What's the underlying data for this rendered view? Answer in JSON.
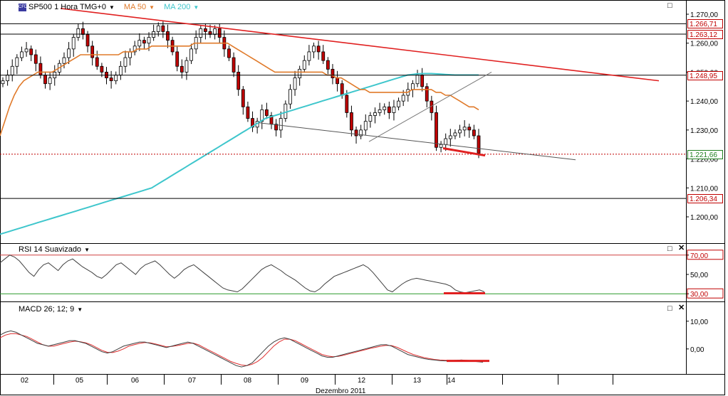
{
  "header": {
    "symbol": "SP500 1 Hora TMG+0",
    "ma50_label": "MA 50",
    "ma200_label": "MA 200",
    "rsi_label": "RSI 14 Suavizado",
    "macd_label": "MACD 26; 12; 9",
    "logo_text": "CFD"
  },
  "colors": {
    "candle_up": "#ffffff",
    "candle_down": "#c00000",
    "ma50": "#e07a2a",
    "ma200": "#3ec6cc",
    "trendline": "#e02020",
    "support": "#c00000",
    "macd": "#404040",
    "signal": "#e03030"
  },
  "axis": {
    "x_title": "Dezembro 2011",
    "day_labels": [
      "02",
      "05",
      "06",
      "07",
      "08",
      "09",
      "12",
      "13",
      "14"
    ],
    "price_ticks": [
      "1.270,00",
      "1.260,00",
      "1.250,00",
      "1.240,00",
      "1.230,00",
      "1.220,00",
      "1.210,00",
      "1.200,00"
    ],
    "rsi_ticks": [
      "70,00",
      "50,00",
      "30,00"
    ],
    "macd_ticks": [
      "10,00",
      "0,00"
    ]
  },
  "levels": [
    {
      "label": "1.266,71",
      "value": 1266.71,
      "color": "#c00000"
    },
    {
      "label": "1.263,12",
      "value": 1263.12,
      "color": "#c00000"
    },
    {
      "label": "1.248,95",
      "value": 1248.95,
      "color": "#c00000"
    },
    {
      "label": "1.221,66",
      "value": 1221.66,
      "color": "#208020"
    },
    {
      "label": "1.206,34",
      "value": 1206.34,
      "color": "#c00000"
    }
  ],
  "chart_data": [
    {
      "type": "candlestick",
      "title": "SP500 1 Hora TMG+0",
      "xlabel": "Dezembro 2011",
      "ylim": [
        1190,
        1272
      ],
      "categories": [
        "02",
        "05",
        "06",
        "07",
        "08",
        "09",
        "12",
        "13",
        "14"
      ],
      "close_series": [
        1247,
        1249,
        1252,
        1255,
        1257,
        1258,
        1256,
        1253,
        1249,
        1246,
        1248,
        1250,
        1253,
        1255,
        1258,
        1262,
        1265,
        1263,
        1259,
        1255,
        1252,
        1250,
        1248,
        1247,
        1249,
        1252,
        1255,
        1257,
        1259,
        1261,
        1260,
        1262,
        1264,
        1266,
        1264,
        1261,
        1257,
        1252,
        1250,
        1254,
        1258,
        1262,
        1265,
        1264,
        1263,
        1265,
        1262,
        1258,
        1255,
        1250,
        1244,
        1238,
        1234,
        1231,
        1233,
        1237,
        1235,
        1232,
        1230,
        1234,
        1239,
        1244,
        1248,
        1251,
        1254,
        1257,
        1259,
        1257,
        1254,
        1251,
        1248,
        1246,
        1242,
        1236,
        1230,
        1228,
        1230,
        1233,
        1235,
        1236,
        1237,
        1238,
        1236,
        1238,
        1240,
        1242,
        1244,
        1246,
        1249,
        1245,
        1240,
        1236,
        1224,
        1225,
        1227,
        1228,
        1229,
        1230,
        1231,
        1230,
        1228,
        1222
      ],
      "series": [
        {
          "name": "MA 50",
          "values": [
            1228,
            1233,
            1238,
            1242,
            1245,
            1247,
            1248,
            1249,
            1250,
            1250,
            1250,
            1250,
            1251,
            1252,
            1253,
            1254,
            1255,
            1256,
            1256,
            1256,
            1256,
            1256,
            1256,
            1256,
            1256,
            1256,
            1257,
            1257,
            1257,
            1258,
            1258,
            1258,
            1259,
            1259,
            1259,
            1259,
            1259,
            1259,
            1259,
            1259,
            1259,
            1260,
            1260,
            1260,
            1260,
            1260,
            1260,
            1260,
            1260,
            1259,
            1258,
            1257,
            1256,
            1255,
            1254,
            1253,
            1252,
            1251,
            1250,
            1250,
            1250,
            1250,
            1250,
            1250,
            1250,
            1250,
            1250,
            1250,
            1250,
            1249,
            1249,
            1248,
            1248,
            1247,
            1246,
            1245,
            1244,
            1244,
            1243,
            1243,
            1243,
            1243,
            1243,
            1243,
            1243,
            1243,
            1243,
            1244,
            1244,
            1244,
            1244,
            1244,
            1243,
            1243,
            1242,
            1242,
            1241,
            1240,
            1239,
            1238,
            1238,
            1237
          ]
        },
        {
          "name": "MA 200",
          "values": [
            1194,
            1194.5,
            1195,
            1195.5,
            1196,
            1196.5,
            1197,
            1197.5,
            1198,
            1198.5,
            1199,
            1199.5,
            1200,
            1200.5,
            1201,
            1201.5,
            1202,
            1202.5,
            1203,
            1203.5,
            1204,
            1204.5,
            1205,
            1205.5,
            1206,
            1206.5,
            1207,
            1207.5,
            1208,
            1208.5,
            1209,
            1209.5,
            1210,
            1211,
            1212,
            1213,
            1214,
            1215,
            1216,
            1217,
            1218,
            1219,
            1220,
            1221,
            1222,
            1223,
            1224,
            1225,
            1226,
            1227,
            1228,
            1229,
            1230,
            1231,
            1232,
            1233,
            1234,
            1234.5,
            1235,
            1235.5,
            1236,
            1236.5,
            1237,
            1237.5,
            1238,
            1238.5,
            1239,
            1239.5,
            1240,
            1240.5,
            1241,
            1241.5,
            1242,
            1242.5,
            1243,
            1243.5,
            1244,
            1244.5,
            1245,
            1245.5,
            1246,
            1246.5,
            1247,
            1247.5,
            1248,
            1248.5,
            1249,
            1249.2,
            1249.4,
            1249.5,
            1249.5,
            1249.5,
            1249.4,
            1249.3,
            1249.2,
            1249.1,
            1249.0,
            1249.0,
            1249.0,
            1249.0,
            1249.0,
            1249.0
          ]
        }
      ]
    },
    {
      "type": "line",
      "title": "RSI 14 Suavizado",
      "ylim": [
        25,
        75
      ],
      "levels": [
        70,
        30
      ],
      "series": [
        {
          "name": "RSI 14 Suavizado",
          "values": [
            62,
            66,
            70,
            68,
            64,
            58,
            52,
            48,
            55,
            60,
            62,
            58,
            54,
            60,
            64,
            66,
            62,
            58,
            55,
            52,
            48,
            46,
            50,
            55,
            60,
            62,
            58,
            54,
            50,
            56,
            60,
            62,
            64,
            60,
            55,
            50,
            46,
            50,
            55,
            58,
            60,
            56,
            52,
            48,
            44,
            40,
            36,
            34,
            33,
            32,
            35,
            40,
            45,
            50,
            55,
            58,
            60,
            57,
            54,
            50,
            47,
            44,
            40,
            36,
            33,
            32,
            35,
            40,
            44,
            48,
            50,
            52,
            54,
            56,
            58,
            60,
            57,
            52,
            46,
            40,
            34,
            32,
            36,
            40,
            43,
            45,
            46,
            45,
            44,
            43,
            42,
            41,
            40,
            38,
            34,
            32,
            31,
            32,
            33,
            34,
            32
          ]
        }
      ]
    },
    {
      "type": "line",
      "title": "MACD 26; 12; 9",
      "ylim": [
        -8,
        12
      ],
      "series": [
        {
          "name": "MACD",
          "values": [
            5,
            6,
            6.5,
            6,
            5,
            4,
            3,
            2,
            1.5,
            1,
            1.5,
            2,
            2.5,
            3,
            3,
            2.5,
            2,
            1,
            0,
            -1,
            -1.5,
            -1,
            0,
            1,
            1.5,
            2,
            2.5,
            2.5,
            2,
            1.5,
            1,
            0.5,
            1,
            1.5,
            2,
            2.5,
            2,
            1,
            0,
            -1,
            -2,
            -3,
            -4,
            -5,
            -6,
            -6.5,
            -6,
            -5,
            -3,
            -1,
            1,
            2.5,
            3.5,
            4,
            3.5,
            2.5,
            1.5,
            0.5,
            -0.5,
            -1.5,
            -2.5,
            -3,
            -3,
            -2.5,
            -2,
            -1.5,
            -1,
            -0.5,
            0,
            0.5,
            1,
            1.5,
            1.5,
            1,
            0,
            -1,
            -2,
            -2.5,
            -3,
            -3.5,
            -3.8,
            -4,
            -4.2,
            -4.3,
            -4.2,
            -4.1,
            -4.0,
            -4.2,
            -4.4,
            -4.6,
            -4.8
          ]
        },
        {
          "name": "Signal",
          "values": [
            4,
            5,
            5.5,
            5.5,
            5,
            4.5,
            3.5,
            2.5,
            1.5,
            1,
            1,
            1.5,
            2,
            2.5,
            2.8,
            2.6,
            2.2,
            1.5,
            0.5,
            -0.5,
            -1.2,
            -1.3,
            -0.8,
            0,
            1,
            1.5,
            2,
            2.3,
            2.2,
            1.8,
            1.3,
            0.8,
            0.9,
            1.2,
            1.6,
            2,
            2.1,
            1.5,
            0.5,
            -0.5,
            -1.5,
            -2.5,
            -3.5,
            -4.5,
            -5.2,
            -5.8,
            -6,
            -5.5,
            -4.5,
            -3,
            -1,
            1,
            2.5,
            3.5,
            3.5,
            3,
            2,
            1,
            0,
            -1,
            -2,
            -2.5,
            -2.8,
            -2.7,
            -2.3,
            -1.8,
            -1.3,
            -0.8,
            -0.3,
            0.2,
            0.6,
            1,
            1.3,
            1.2,
            0.6,
            -0.3,
            -1.2,
            -2,
            -2.6,
            -3.1,
            -3.5,
            -3.8,
            -4.0,
            -4.1,
            -4.1,
            -4.1,
            -4.0,
            -4.1,
            -4.2,
            -4.3,
            -4.5
          ]
        }
      ]
    }
  ]
}
